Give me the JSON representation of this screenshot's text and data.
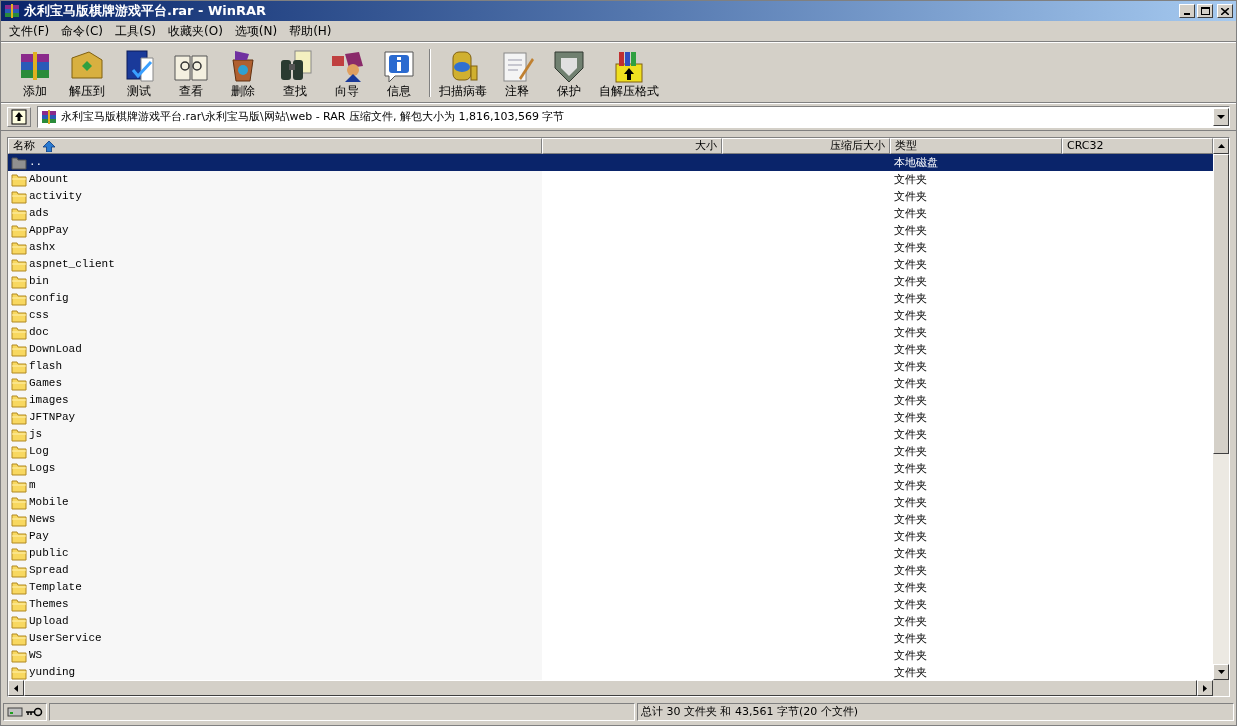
{
  "window": {
    "title": "永利宝马版棋牌游戏平台.rar - WinRAR"
  },
  "menu": [
    "文件(F)",
    "命令(C)",
    "工具(S)",
    "收藏夹(O)",
    "选项(N)",
    "帮助(H)"
  ],
  "toolbar": [
    {
      "label": "添加"
    },
    {
      "label": "解压到"
    },
    {
      "label": "测试"
    },
    {
      "label": "查看"
    },
    {
      "label": "删除"
    },
    {
      "label": "查找"
    },
    {
      "label": "向导"
    },
    {
      "label": "信息"
    },
    {
      "label": "扫描病毒"
    },
    {
      "label": "注释"
    },
    {
      "label": "保护"
    },
    {
      "label": "自解压格式"
    }
  ],
  "address": {
    "value": "永利宝马版棋牌游戏平台.rar\\永利宝马版\\网站\\web - RAR 压缩文件, 解包大小为 1,816,103,569 字节"
  },
  "table": {
    "columns": [
      "名称",
      "大小",
      "压缩后大小",
      "类型",
      "CRC32"
    ],
    "rows": [
      {
        "kind": "parent",
        "name": "..",
        "type": "本地磁盘",
        "selected": true
      },
      {
        "kind": "folder",
        "name": "Abount",
        "type": "文件夹",
        "selected": false
      },
      {
        "kind": "folder",
        "name": "activity",
        "type": "文件夹",
        "selected": false
      },
      {
        "kind": "folder",
        "name": "ads",
        "type": "文件夹",
        "selected": false
      },
      {
        "kind": "folder",
        "name": "AppPay",
        "type": "文件夹",
        "selected": false
      },
      {
        "kind": "folder",
        "name": "ashx",
        "type": "文件夹",
        "selected": false
      },
      {
        "kind": "folder",
        "name": "aspnet_client",
        "type": "文件夹",
        "selected": false
      },
      {
        "kind": "folder",
        "name": "bin",
        "type": "文件夹",
        "selected": false
      },
      {
        "kind": "folder",
        "name": "config",
        "type": "文件夹",
        "selected": false
      },
      {
        "kind": "folder",
        "name": "css",
        "type": "文件夹",
        "selected": false
      },
      {
        "kind": "folder",
        "name": "doc",
        "type": "文件夹",
        "selected": false
      },
      {
        "kind": "folder",
        "name": "DownLoad",
        "type": "文件夹",
        "selected": false
      },
      {
        "kind": "folder",
        "name": "flash",
        "type": "文件夹",
        "selected": false
      },
      {
        "kind": "folder",
        "name": "Games",
        "type": "文件夹",
        "selected": false
      },
      {
        "kind": "folder",
        "name": "images",
        "type": "文件夹",
        "selected": false
      },
      {
        "kind": "folder",
        "name": "JFTNPay",
        "type": "文件夹",
        "selected": false
      },
      {
        "kind": "folder",
        "name": "js",
        "type": "文件夹",
        "selected": false
      },
      {
        "kind": "folder",
        "name": "Log",
        "type": "文件夹",
        "selected": false
      },
      {
        "kind": "folder",
        "name": "Logs",
        "type": "文件夹",
        "selected": false
      },
      {
        "kind": "folder",
        "name": "m",
        "type": "文件夹",
        "selected": false
      },
      {
        "kind": "folder",
        "name": "Mobile",
        "type": "文件夹",
        "selected": false
      },
      {
        "kind": "folder",
        "name": "News",
        "type": "文件夹",
        "selected": false
      },
      {
        "kind": "folder",
        "name": "Pay",
        "type": "文件夹",
        "selected": false
      },
      {
        "kind": "folder",
        "name": "public",
        "type": "文件夹",
        "selected": false
      },
      {
        "kind": "folder",
        "name": "Spread",
        "type": "文件夹",
        "selected": false
      },
      {
        "kind": "folder",
        "name": "Template",
        "type": "文件夹",
        "selected": false
      },
      {
        "kind": "folder",
        "name": "Themes",
        "type": "文件夹",
        "selected": false
      },
      {
        "kind": "folder",
        "name": "Upload",
        "type": "文件夹",
        "selected": false
      },
      {
        "kind": "folder",
        "name": "UserService",
        "type": "文件夹",
        "selected": false
      },
      {
        "kind": "folder",
        "name": "WS",
        "type": "文件夹",
        "selected": false
      },
      {
        "kind": "folder",
        "name": "yunding",
        "type": "文件夹",
        "selected": false
      }
    ]
  },
  "status_bar": {
    "summary": "总计 30 文件夹 和 43,561 字节(20 个文件)"
  }
}
